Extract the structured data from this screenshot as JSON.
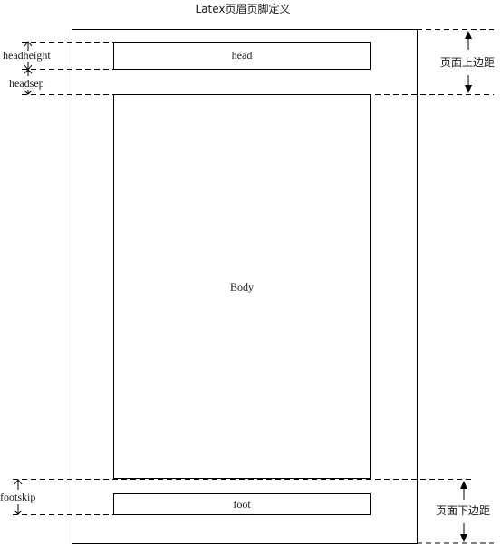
{
  "title": "Latex页眉页脚定义",
  "regions": {
    "head": "head",
    "body": "Body",
    "foot": "foot"
  },
  "dimensions": {
    "headheight": "headheight",
    "headsep": "headsep",
    "footskip": "footskip"
  },
  "margins": {
    "top": "页面上边距",
    "bottom": "页面下边距"
  }
}
